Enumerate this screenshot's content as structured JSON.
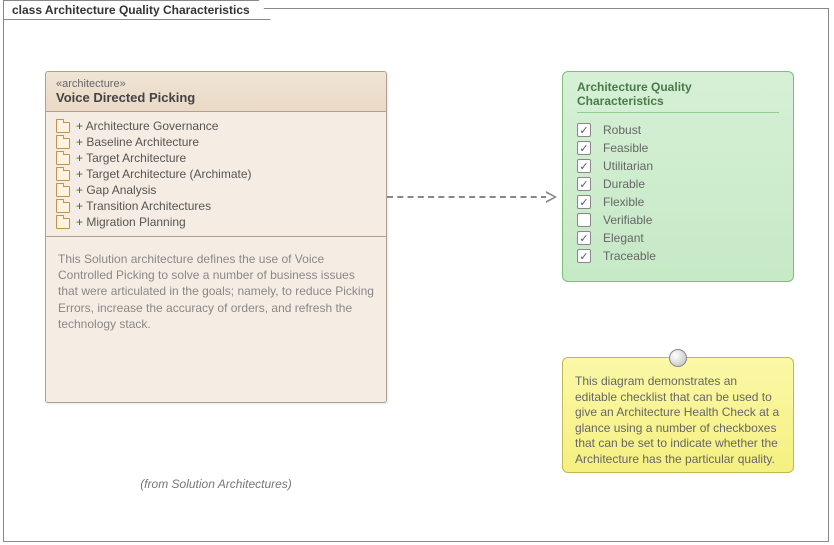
{
  "frame": {
    "title": "class Architecture Quality Characteristics"
  },
  "class": {
    "stereotype": "«architecture»",
    "name": "Voice Directed Picking",
    "packages": [
      "+ Architecture Governance",
      "+ Baseline Architecture",
      "+ Target Architecture",
      "+ Target Architecture (Archimate)",
      "+ Gap Analysis",
      "+ Transition Architectures",
      "+ Migration Planning"
    ],
    "description": "This Solution architecture defines the use of Voice Controlled Picking to solve a number of business issues that were articulated in the goals; namely, to reduce Picking Errors, increase the accuracy of orders, and refresh the technology stack.",
    "caption": "(from Solution Architectures)"
  },
  "checklist": {
    "title": "Architecture Quality Characteristics",
    "items": [
      {
        "label": "Robust",
        "checked": true
      },
      {
        "label": "Feasible",
        "checked": true
      },
      {
        "label": "Utilitarian",
        "checked": true
      },
      {
        "label": "Durable",
        "checked": true
      },
      {
        "label": "Flexible",
        "checked": true
      },
      {
        "label": "Verifiable",
        "checked": false
      },
      {
        "label": "Elegant",
        "checked": true
      },
      {
        "label": "Traceable",
        "checked": true
      }
    ]
  },
  "note": {
    "text": "This diagram demonstrates an editable checklist that can be used to give an Architecture Health Check at a glance using a number of checkboxes that can be set to indicate whether the Architecture has the particular quality."
  }
}
